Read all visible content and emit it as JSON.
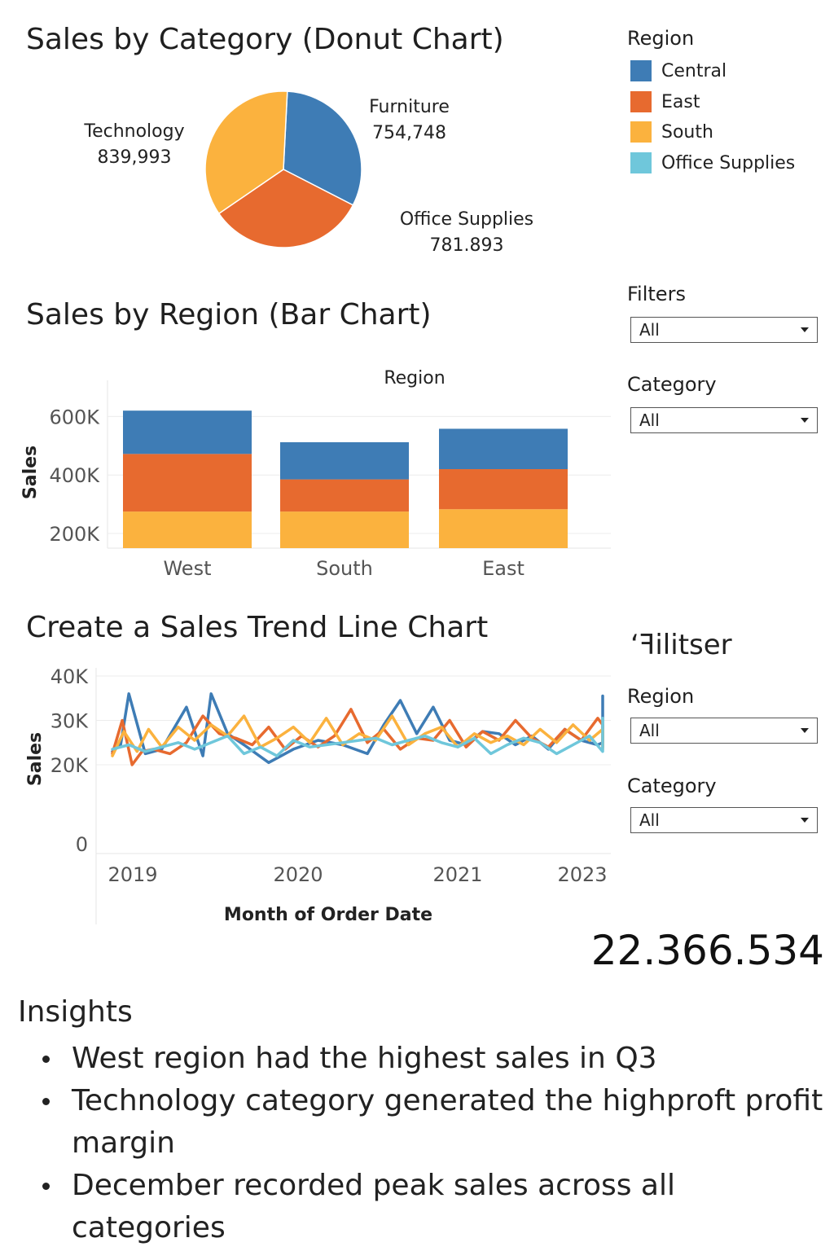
{
  "colors": {
    "central": "#3E7CB5",
    "east": "#E76A2F",
    "south": "#FBB23E",
    "office_supplies": "#6FC7DB"
  },
  "donut": {
    "title": "Sales by Category (Donut Chart)"
  },
  "bar": {
    "title": "Sales by Region (Bar Chart)"
  },
  "line": {
    "title": "Create a Sales Trend Line Chart"
  },
  "legend": {
    "title": "Region",
    "items": [
      {
        "label": "Central",
        "color": "#3E7CB5"
      },
      {
        "label": "East",
        "color": "#E76A2F"
      },
      {
        "label": "South",
        "color": "#FBB23E"
      },
      {
        "label": "Office Supplies",
        "color": "#6FC7DB"
      }
    ]
  },
  "filters": {
    "title": "Filters",
    "filter1": {
      "value": "All"
    },
    "category_label": "Category",
    "category1": {
      "value": "All"
    },
    "garbled_title": "ʻꟻilitser",
    "region_label": "Region",
    "region2": {
      "value": "All"
    },
    "category_label2": "Category",
    "category2": {
      "value": "All"
    }
  },
  "kpi": {
    "value": "22.366.534"
  },
  "insights": {
    "title": "Insights",
    "items": [
      "West region had the highest sales in Q3",
      "Technology category generated the highproft profit margin",
      "December recorded peak sales across all categories"
    ]
  },
  "chart_data": [
    {
      "type": "pie",
      "title": "Sales by Category (Donut Chart)",
      "slices": [
        {
          "label": "Furniture",
          "value_label": "754,748",
          "value": 754748,
          "color": "#3E7CB5"
        },
        {
          "label": "Office Supplies",
          "value_label": "781.893",
          "value": 781893,
          "color": "#E76A2F"
        },
        {
          "label": "Technology",
          "value_label": "839,993",
          "value": 839993,
          "color": "#FBB23E"
        }
      ]
    },
    {
      "type": "bar",
      "title": "Sales by Region (Bar Chart)",
      "stacked": true,
      "legend_title": "Region",
      "categories": [
        "West",
        "South",
        "East"
      ],
      "ylabel": "Sales",
      "ylim": [
        150000,
        640000
      ],
      "yticks": [
        200000,
        400000,
        600000
      ],
      "ytick_labels": [
        "200K",
        "400K",
        "600K"
      ],
      "grid": true,
      "series": [
        {
          "color": "#FBB23E",
          "values": [
            275000,
            275000,
            283000
          ]
        },
        {
          "color": "#E76A2F",
          "values": [
            472000,
            385000,
            420000
          ]
        },
        {
          "color": "#3E7CB5",
          "values": [
            620000,
            512000,
            558000
          ]
        }
      ]
    },
    {
      "type": "line",
      "title": "Create a Sales Trend Line Chart",
      "xlabel": "Month of Order Date",
      "ylabel": "Sales",
      "xticks": [
        "2019",
        "2020",
        "2021",
        "2023"
      ],
      "xlim": [
        2018.75,
        2023.2
      ],
      "ylim": [
        0,
        40000
      ],
      "yticks": [
        0,
        20000,
        30000,
        40000
      ],
      "ytick_labels": [
        "0",
        "20K",
        "30K",
        "40K"
      ],
      "grid": true,
      "series": [
        {
          "color": "#3E7CB5",
          "x": [
            2019.0,
            2019.05,
            2019.1,
            2019.2,
            2019.3,
            2019.45,
            2019.55,
            2019.6,
            2019.7,
            2019.8,
            2019.95,
            2020.1,
            2020.25,
            2020.4,
            2020.55,
            2020.65,
            2020.75,
            2020.85,
            2020.95,
            2021.05,
            2021.15,
            2021.25,
            2021.35,
            2021.45,
            2021.55,
            2021.65,
            2021.75,
            2021.85,
            2021.95,
            2022.0,
            2022.1,
            2022.2,
            2022.3,
            2022.4,
            2022.5,
            2022.6,
            2022.7,
            2022.8,
            2022.9,
            2023.0,
            2023.1,
            2023.2
          ],
          "y": [
            23000,
            24500,
            36000,
            22500,
            23500,
            33000,
            22000,
            36000,
            27000,
            24500,
            20500,
            23500,
            25500,
            24500,
            22500,
            29000,
            34500,
            27000,
            33000,
            25500,
            24500,
            27500,
            27000,
            24500,
            26500,
            23500,
            28000,
            25500,
            24500,
            25000,
            28000,
            33000,
            26500,
            29000,
            30500,
            35500,
            28000,
            28000,
            28000,
            28000,
            28000,
            28000
          ]
        },
        {
          "color": "#E76A2F",
          "x": [
            2019.0,
            2019.06,
            2019.12,
            2019.18,
            2019.25,
            2019.35,
            2019.45,
            2019.55,
            2019.65,
            2019.75,
            2019.85,
            2019.95,
            2020.05,
            2020.15,
            2020.25,
            2020.35,
            2020.45,
            2020.55,
            2020.65,
            2020.75,
            2020.85,
            2020.95,
            2021.05,
            2021.15,
            2021.25,
            2021.35,
            2021.45,
            2021.55,
            2021.65,
            2021.75,
            2021.85,
            2021.95,
            2022.05,
            2022.15,
            2022.25,
            2022.35,
            2022.45,
            2022.55,
            2022.65,
            2022.75,
            2022.85,
            2022.95
          ],
          "y": [
            22500,
            30000,
            20000,
            23000,
            23500,
            22500,
            25000,
            31000,
            27000,
            26000,
            24500,
            28500,
            23500,
            26500,
            24000,
            26500,
            32500,
            25000,
            28000,
            23500,
            26000,
            25500,
            30000,
            24000,
            27500,
            25500,
            30000,
            26000,
            24000,
            28000,
            25500,
            30500,
            29000,
            24000,
            25500,
            27500,
            26000,
            24000,
            28500,
            26000,
            28500,
            25000
          ]
        },
        {
          "color": "#FBB23E",
          "x": [
            2019.0,
            2019.07,
            2019.15,
            2019.22,
            2019.3,
            2019.4,
            2019.5,
            2019.6,
            2019.7,
            2019.8,
            2019.9,
            2020.0,
            2020.1,
            2020.2,
            2020.3,
            2020.4,
            2020.5,
            2020.6,
            2020.7,
            2020.8,
            2020.9,
            2021.0,
            2021.1,
            2021.2,
            2021.3,
            2021.4,
            2021.5,
            2021.6,
            2021.7,
            2021.8,
            2021.9,
            2022.0,
            2022.1,
            2022.2,
            2022.3,
            2022.4,
            2022.5,
            2022.6,
            2022.7,
            2022.8,
            2022.9,
            2023.0
          ],
          "y": [
            22000,
            27500,
            23000,
            28000,
            24000,
            28500,
            25500,
            29000,
            26500,
            31000,
            24000,
            26000,
            28500,
            25000,
            30500,
            24500,
            27000,
            25500,
            31000,
            24500,
            27000,
            28500,
            24000,
            27000,
            25000,
            26500,
            24500,
            28000,
            25000,
            29000,
            25500,
            28000,
            24000,
            26000,
            23500,
            27000,
            25500,
            28000,
            24500,
            27500,
            25500,
            26500
          ]
        },
        {
          "color": "#6FC7DB",
          "x": [
            2019.0,
            2019.1,
            2019.2,
            2019.3,
            2019.4,
            2019.5,
            2019.6,
            2019.7,
            2019.8,
            2019.9,
            2020.0,
            2020.1,
            2020.2,
            2020.3,
            2020.4,
            2020.5,
            2020.6,
            2020.7,
            2020.8,
            2020.9,
            2021.0,
            2021.1,
            2021.2,
            2021.3,
            2021.4,
            2021.5,
            2021.6,
            2021.7,
            2021.8,
            2021.9,
            2022.0,
            2022.1,
            2022.2,
            2022.3,
            2022.4,
            2022.5,
            2022.6,
            2022.7,
            2022.8,
            2022.9,
            2023.0,
            2023.1
          ],
          "y": [
            23500,
            24500,
            23000,
            24000,
            25000,
            23500,
            25000,
            26500,
            22500,
            24000,
            22000,
            25500,
            24000,
            24500,
            25000,
            25500,
            26000,
            24500,
            25500,
            26500,
            25000,
            24000,
            26000,
            22500,
            24500,
            26000,
            25000,
            22500,
            24500,
            26500,
            23000,
            24000,
            26000,
            25500,
            24500,
            28000,
            26500,
            27500,
            29500,
            30500,
            29000,
            30000
          ]
        }
      ]
    }
  ]
}
